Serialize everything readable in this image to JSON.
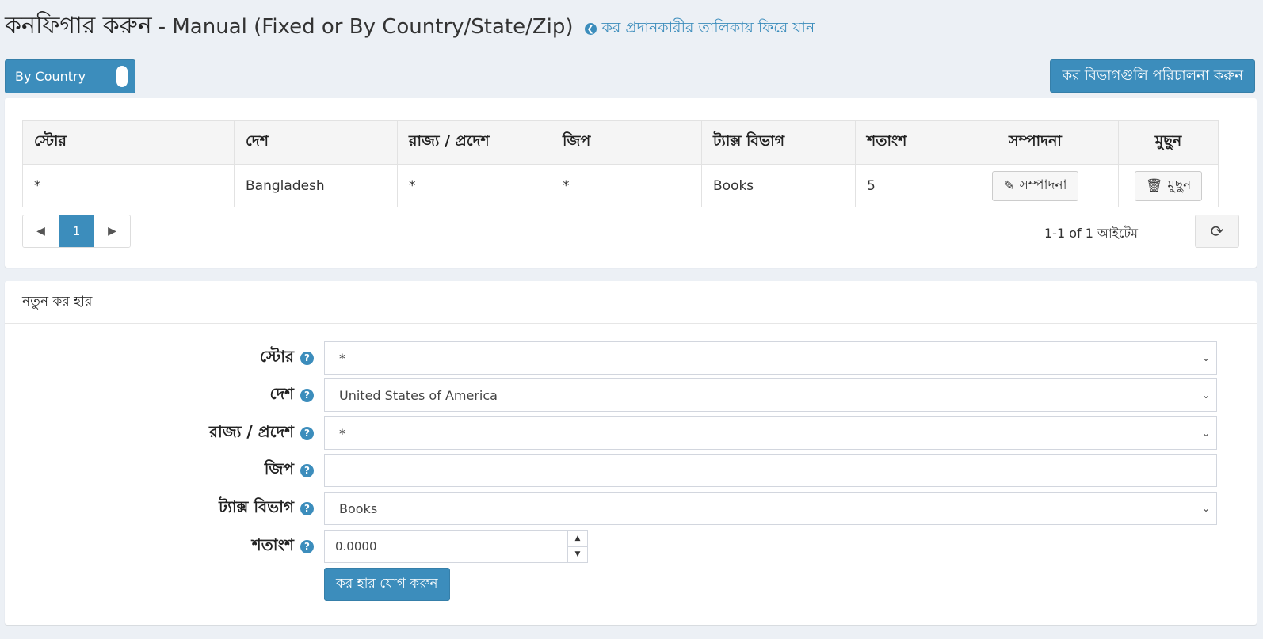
{
  "header": {
    "title": "কনফিগার করুন",
    "subtitle": "- Manual (Fixed or By Country/State/Zip)",
    "back_link": "কর প্রদানকারীর তালিকায় ফিরে যান"
  },
  "toolbar": {
    "mode_toggle_label": "By Country",
    "manage_categories_label": "কর বিভাগগুলি পরিচালনা করুন"
  },
  "grid": {
    "columns": [
      "স্টোর",
      "দেশ",
      "রাজ্য / প্রদেশ",
      "জিপ",
      "ট্যাক্স বিভাগ",
      "শতাংশ",
      "সম্পাদনা",
      "মুছুন"
    ],
    "rows": [
      {
        "store": "*",
        "country": "Bangladesh",
        "state": "*",
        "zip": "*",
        "tax_category": "Books",
        "percentage": "5",
        "edit_label": "সম্পাদনা",
        "delete_label": "মুছুন"
      }
    ],
    "pager": {
      "current_page": "1",
      "info": "1-1 of 1 আইটেম"
    }
  },
  "new_rate": {
    "heading": "নতুন কর হার",
    "store_label": "স্টোর",
    "store_value": "*",
    "country_label": "দেশ",
    "country_value": "United States of America",
    "state_label": "রাজ্য / প্রদেশ",
    "state_value": "*",
    "zip_label": "জিপ",
    "zip_value": "",
    "tax_category_label": "ট্যাক্স বিভাগ",
    "tax_category_value": "Books",
    "percentage_label": "শতাংশ",
    "percentage_value": "0.0000",
    "add_button_label": "কর হার যোগ করুন"
  },
  "colors": {
    "primary": "#3c8dbc",
    "background": "#ecf0f5",
    "panel": "#ffffff"
  },
  "icons": {
    "back": "arrow-circle-left-icon",
    "help": "question-circle-icon",
    "edit": "pencil-icon",
    "delete": "trash-icon",
    "refresh": "refresh-icon"
  }
}
